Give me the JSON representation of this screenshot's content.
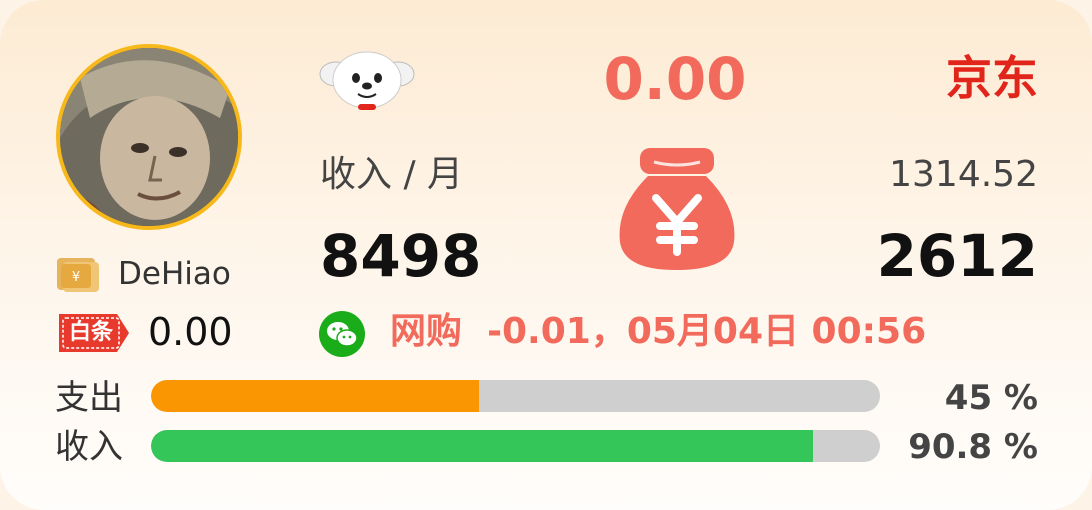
{
  "user": {
    "avatar_icon": "user-avatar-photo",
    "name": "DeHiao",
    "coupon_icon": "coupon-yuan-icon",
    "baitiao_badge": "白条",
    "baitiao_value": "0.00"
  },
  "header": {
    "mascot_icon": "jd-dog-mascot-icon",
    "amount": "0.00",
    "brand": "京东"
  },
  "income": {
    "label": "收入 / 月",
    "value": "8498",
    "bag_icon": "money-bag-yuan-icon",
    "right_small": "1314.52",
    "right_big": "2612"
  },
  "transaction": {
    "icon": "wechat-icon",
    "text": "网购  -0.01，05月04日 00:56"
  },
  "bars": [
    {
      "label": "支出",
      "percent": 45,
      "percent_text": "45 %",
      "color": "#fb9603"
    },
    {
      "label": "收入",
      "percent": 90.8,
      "percent_text": "90.8 %",
      "color": "#34c659"
    }
  ],
  "colors": {
    "accent_red": "#f26a5b",
    "brand_red": "#e1251b",
    "avatar_ring": "#f6b81a",
    "track": "#cfcfcf"
  }
}
